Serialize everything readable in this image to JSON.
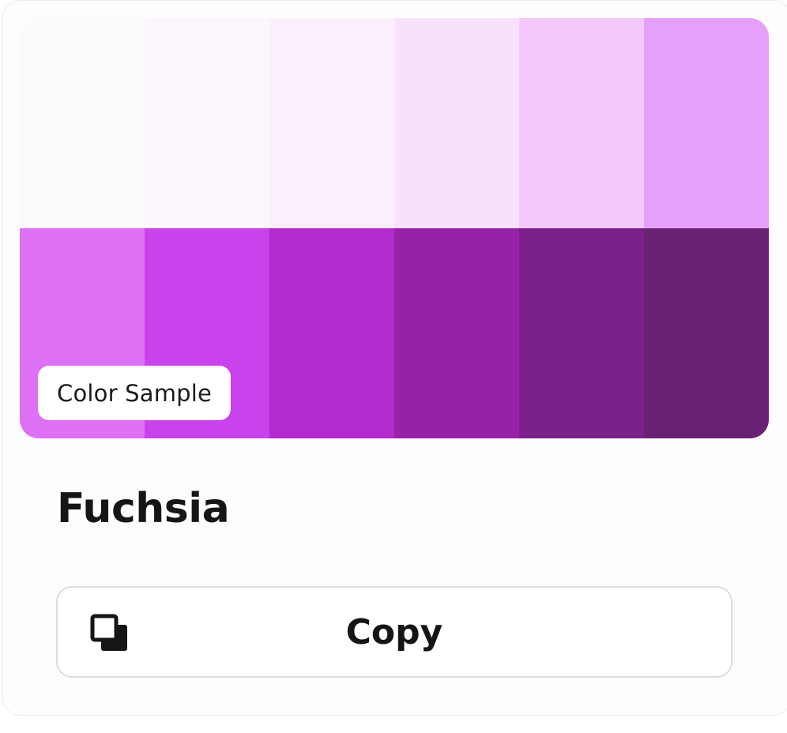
{
  "palette": {
    "badge_label": "Color Sample",
    "swatches": [
      "#fcfafd",
      "#fdf6fd",
      "#fbeffc",
      "#f8e1fd",
      "#f4c8fc",
      "#e7a0f9",
      "#dd70f5",
      "#c942eb",
      "#b32acf",
      "#9721a9",
      "#7b208b",
      "#692273"
    ]
  },
  "color": {
    "name": "Fuchsia"
  },
  "actions": {
    "copy_label": "Copy",
    "copy_icon": "copy-icon"
  }
}
